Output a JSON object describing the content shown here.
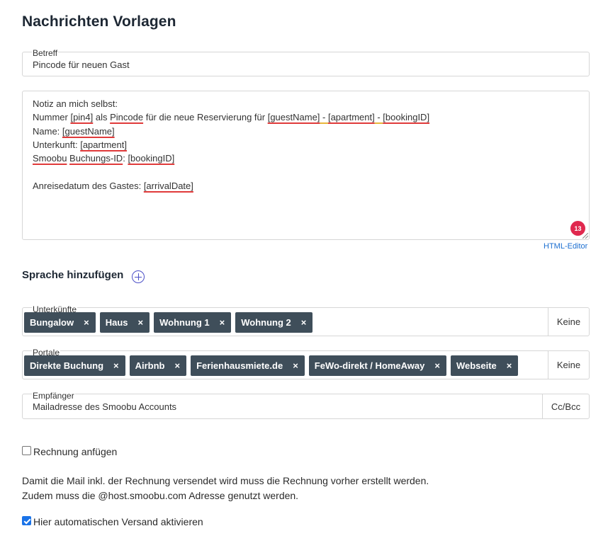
{
  "page": {
    "title": "Nachrichten Vorlagen"
  },
  "subject": {
    "legend": "Betreff",
    "value": "Pincode für neuen Gast"
  },
  "message": {
    "lines": {
      "l1": "Notiz an mich selbst:",
      "l2a": "Nummer ",
      "l2b": "[pin4]",
      "l2c": " als ",
      "l2d": "Pincode",
      "l2e": " für die neue Reservierung für ",
      "l2f": "[guestName]",
      "l2g": " - ",
      "l2h": "[apartment]",
      "l2i": " - ",
      "l2j": "[bookingID]",
      "l3a": "Name: ",
      "l3b": "[guestName]",
      "l4a": "Unterkunft:  ",
      "l4b": "[apartment]",
      "l5a": "Smoobu",
      "l5b": " ",
      "l5c": "Buchungs-ID",
      "l5d": ": ",
      "l5e": "[bookingID]",
      "l6a": "Anreisedatum des Gastes: ",
      "l6b": "[arrivalDate]"
    },
    "error_count": "13",
    "html_editor_link": "HTML-Editor"
  },
  "language": {
    "label": "Sprache hinzufügen"
  },
  "accommodations": {
    "legend": "Unterkünfte",
    "tags": [
      "Bungalow",
      "Haus",
      "Wohnung 1",
      "Wohnung 2"
    ],
    "none_button": "Keine"
  },
  "portals": {
    "legend": "Portale",
    "tags": [
      "Direkte Buchung",
      "Airbnb",
      "Ferienhausmiete.de",
      "FeWo-direkt / HomeAway",
      "Webseite"
    ],
    "none_button": "Keine"
  },
  "recipient": {
    "legend": "Empfänger",
    "value": "Mailadresse des Smoobu Accounts",
    "cc_button": "Cc/Bcc"
  },
  "invoice": {
    "label": "Rechnung anfügen",
    "checked": false
  },
  "note": {
    "line1": "Damit die Mail inkl. der Rechnung versendet wird muss die Rechnung vorher erstellt werden.",
    "line2": "Zudem muss die @host.smoobu.com Adresse genutzt werden."
  },
  "auto_send": {
    "label": "Hier automatischen Versand aktivieren",
    "checked": true
  },
  "colors": {
    "tag_bg": "#3f4e5a",
    "accent": "#1c6fd1",
    "badge": "#e0284e",
    "spell_error": "#e03a3a",
    "spell_warning": "#e8b73a"
  }
}
